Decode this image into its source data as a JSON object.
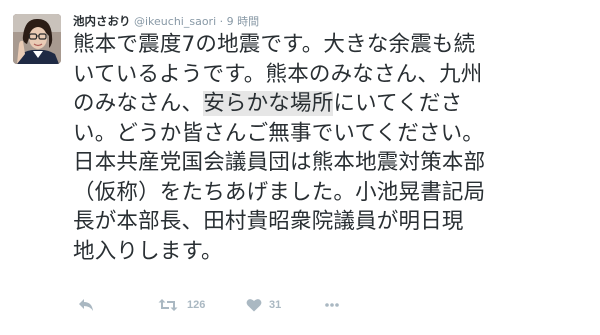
{
  "tweet": {
    "display_name": "池内さおり",
    "handle": "@ikeuchi_saori",
    "separator": "·",
    "timestamp": "9 時間",
    "text_lines": [
      {
        "pre": "熊本で震度7の地震です。大きな余震も続",
        "hl": "",
        "post": ""
      },
      {
        "pre": "いているようです。熊本のみなさん、九州",
        "hl": "",
        "post": ""
      },
      {
        "pre": "のみなさん、",
        "hl": "安らかな場所",
        "post": "にいてくださ"
      },
      {
        "pre": "い。どうか皆さんご無事でいてください。",
        "hl": "",
        "post": ""
      },
      {
        "pre": "日本共産党国会議員団は熊本地震対策本部",
        "hl": "",
        "post": ""
      },
      {
        "pre": "（仮称）をたちあげました。小池晃書記局",
        "hl": "",
        "post": ""
      },
      {
        "pre": "長が本部長、田村貴昭衆院議員が明日現",
        "hl": "",
        "post": ""
      },
      {
        "pre": "地入りします。",
        "hl": "",
        "post": ""
      }
    ]
  },
  "actions": {
    "reply_icon": "reply-arrow-icon",
    "retweet_icon": "retweet-icon",
    "retweet_count": "126",
    "like_icon": "heart-icon",
    "like_count": "31",
    "more_icon": "more-dots-icon"
  },
  "colors": {
    "text": "#292f33",
    "muted": "#8899a6",
    "action_gray": "#aab8c2",
    "highlight": "#e6e6e6"
  }
}
